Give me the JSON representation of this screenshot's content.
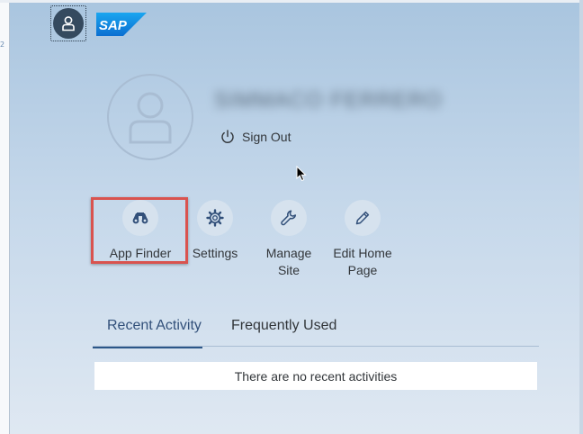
{
  "left_margin": {
    "text": "2"
  },
  "user": {
    "name": "SIMMACO FERRERO"
  },
  "sign_out": {
    "label": "Sign Out",
    "icon": "power-icon"
  },
  "actions": [
    {
      "label": "App Finder",
      "icon": "binoculars-icon"
    },
    {
      "label": "Settings",
      "icon": "gear-icon"
    },
    {
      "label": "Manage Site",
      "icon": "wrench-icon"
    },
    {
      "label": "Edit Home Page",
      "icon": "pencil-icon"
    }
  ],
  "tabs": [
    {
      "label": "Recent Activity",
      "active": true
    },
    {
      "label": "Frequently Used",
      "active": false
    }
  ],
  "recent_activity": {
    "empty_text": "There are no recent activities"
  },
  "colors": {
    "highlight": "#d9534f",
    "brand_blue": "#0a6ed1",
    "shell_dark": "#354a5f",
    "active_tab": "#2c5788"
  }
}
